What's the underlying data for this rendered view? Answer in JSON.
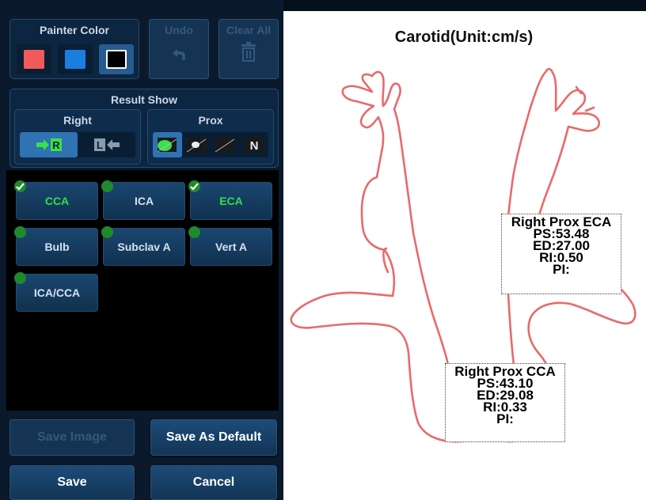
{
  "painter": {
    "title": "Painter Color",
    "colors": [
      "#f05a5a",
      "#1a7ee0",
      "#000000"
    ],
    "selected_index": 2
  },
  "toolbar": {
    "undo_label": "Undo",
    "clear_all_label": "Clear All"
  },
  "result_show": {
    "title": "Result Show",
    "side": {
      "title": "Right",
      "options": [
        "R",
        "L"
      ],
      "selected": "R"
    },
    "position": {
      "title": "Prox",
      "options": [
        "prox-icon",
        "mid-icon",
        "dist-icon",
        "N"
      ],
      "selected_index": 0
    }
  },
  "vessels": [
    {
      "label": "CCA",
      "measured": true
    },
    {
      "label": "ICA",
      "measured": false
    },
    {
      "label": "ECA",
      "measured": true
    },
    {
      "label": "Bulb",
      "measured": false
    },
    {
      "label": "Subclav A",
      "measured": false
    },
    {
      "label": "Vert A",
      "measured": false
    },
    {
      "label": "ICA/CCA",
      "measured": false
    }
  ],
  "actions": {
    "save_image_label": "Save Image",
    "save_default_label": "Save As Default",
    "save_label": "Save",
    "cancel_label": "Cancel"
  },
  "diagram": {
    "title": "Carotid(Unit:cm/s)",
    "outline_color": "#e86a6a",
    "results": [
      {
        "name": "Right Prox ECA",
        "ps": "PS:53.48",
        "ed": "ED:27.00",
        "ri": "RI:0.50",
        "pi": "PI:"
      },
      {
        "name": "Right Prox CCA",
        "ps": "PS:43.10",
        "ed": "ED:29.08",
        "ri": "RI:0.33",
        "pi": "PI:"
      }
    ]
  }
}
